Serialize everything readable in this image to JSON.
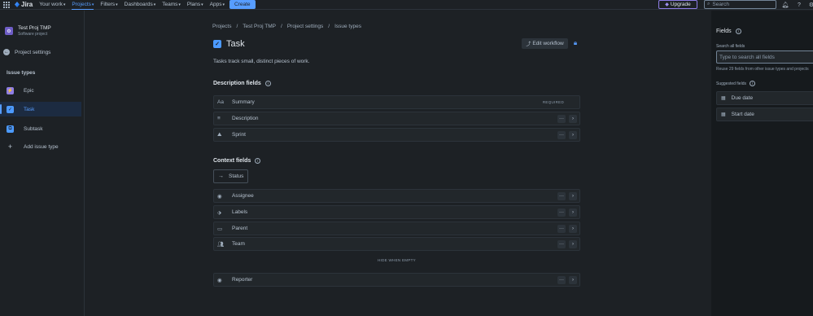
{
  "topnav": {
    "logo": "Jira",
    "items": [
      {
        "label": "Your work"
      },
      {
        "label": "Projects"
      },
      {
        "label": "Filters"
      },
      {
        "label": "Dashboards"
      },
      {
        "label": "Teams"
      },
      {
        "label": "Plans"
      },
      {
        "label": "Apps"
      }
    ],
    "create_label": "Create",
    "upgrade_label": "Upgrade",
    "search_placeholder": "Search"
  },
  "sidebar": {
    "project_name": "Test Proj TMP",
    "project_type": "Software project",
    "back_label": "Project settings",
    "section_title": "Issue types",
    "items": [
      {
        "label": "Epic",
        "color": "#8f7ee7"
      },
      {
        "label": "Task",
        "color": "#4c9aff"
      },
      {
        "label": "Subtask",
        "color": "#4c9aff"
      },
      {
        "label": "Add issue type"
      }
    ]
  },
  "main": {
    "breadcrumb": [
      "Projects",
      "Test Proj TMP",
      "Project settings",
      "Issue types"
    ],
    "title": "Task",
    "edit_workflow_label": "Edit workflow",
    "description": "Tasks track small, distinct pieces of work.",
    "description_fields_title": "Description fields",
    "description_fields": [
      {
        "label": "Summary",
        "badge": "REQUIRED"
      },
      {
        "label": "Description"
      },
      {
        "label": "Sprint"
      }
    ],
    "context_fields_title": "Context fields",
    "status_label": "Status",
    "context_fields": [
      {
        "label": "Assignee"
      },
      {
        "label": "Labels"
      },
      {
        "label": "Parent"
      },
      {
        "label": "Team"
      }
    ],
    "hide_when_empty_label": "HIDE WHEN EMPTY",
    "hidden_fields": [
      {
        "label": "Reporter"
      }
    ]
  },
  "right_panel": {
    "title": "Fields",
    "search_label": "Search all fields",
    "search_placeholder": "Type to search all fields",
    "help_text": "Reuse 29 fields from other issue types and projects",
    "suggested_title": "Suggested fields",
    "suggested": [
      {
        "label": "Due date"
      },
      {
        "label": "Start date"
      }
    ]
  },
  "colors": {
    "accent": "#579dff",
    "background": "#1d2125",
    "panel": "#161a1d"
  }
}
